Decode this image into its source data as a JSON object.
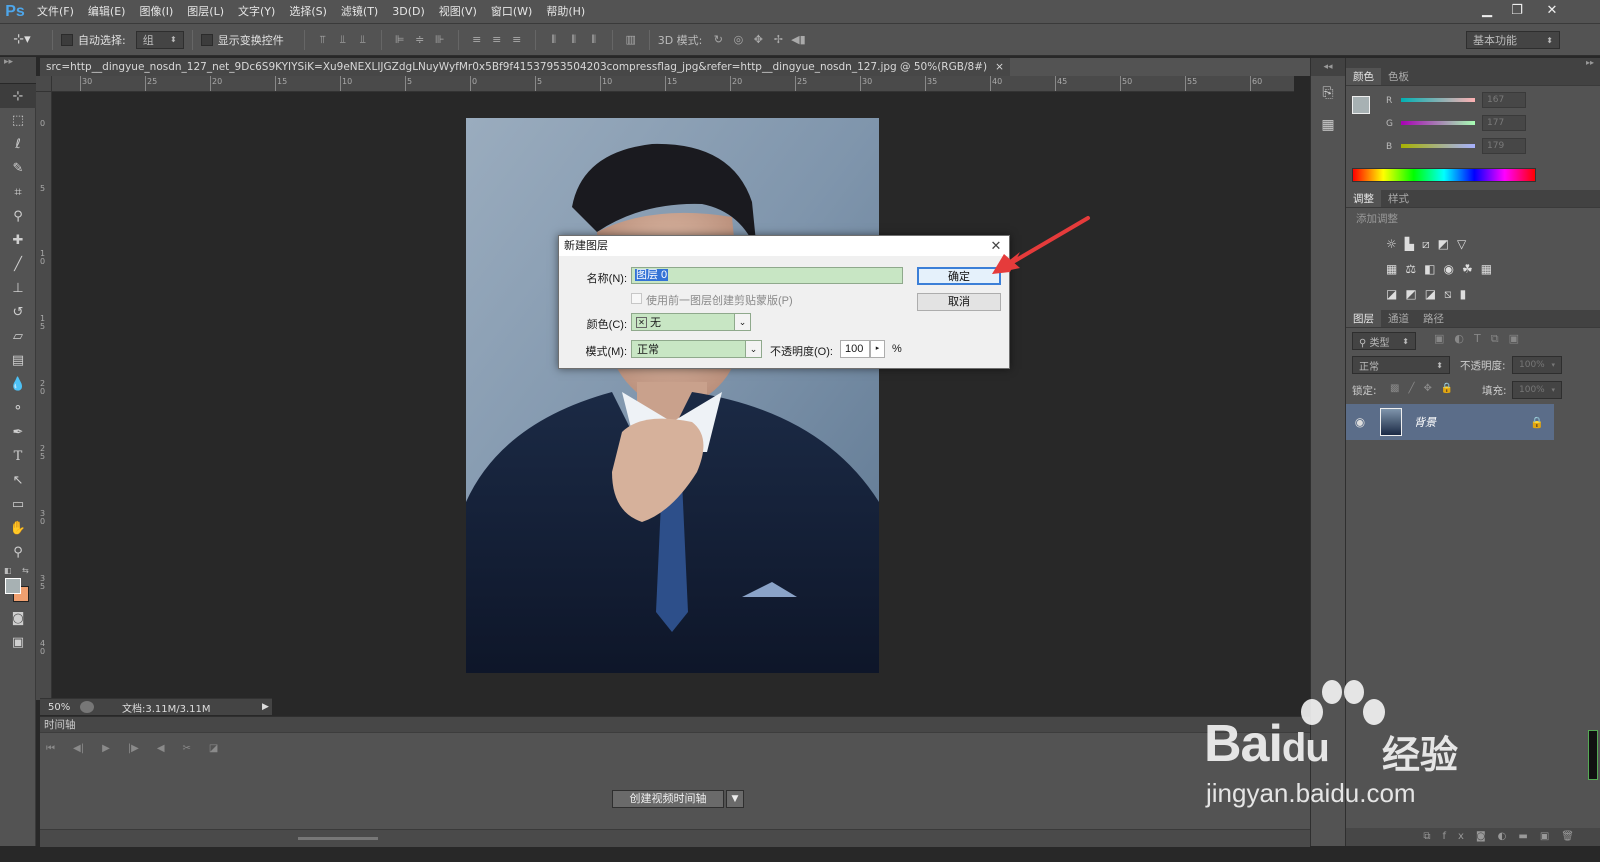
{
  "app": {
    "logo": "Ps"
  },
  "menu": [
    "文件(F)",
    "编辑(E)",
    "图像(I)",
    "图层(L)",
    "文字(Y)",
    "选择(S)",
    "滤镜(T)",
    "3D(D)",
    "视图(V)",
    "窗口(W)",
    "帮助(H)"
  ],
  "options": {
    "auto_select_label": "自动选择:",
    "auto_select_value": "组",
    "transform_controls_label": "显示变换控件",
    "mode_3d_label": "3D 模式:",
    "workspace": "基本功能"
  },
  "document": {
    "tab_title": "src=http__dingyue_nosdn_127_net_9Dc6S9KYIYSiK=Xu9eNEXLIJGZdgLNuyWyfMr0x5Bf9f41537953504203compressflag_jpg&refer=http__dingyue_nosdn_127.jpg @ 50%(RGB/8#)",
    "close_glyph": "×"
  },
  "rulers": {
    "h_ticks": [
      "30",
      "25",
      "20",
      "15",
      "10",
      "5",
      "0",
      "5",
      "10",
      "15",
      "20",
      "25",
      "30",
      "35",
      "40",
      "45",
      "50",
      "55",
      "60"
    ],
    "v_ticks": [
      "0",
      "5",
      "1\n0",
      "1\n5",
      "2\n0",
      "2\n5",
      "3\n0",
      "3\n5",
      "4\n0"
    ]
  },
  "status": {
    "zoom": "50%",
    "doc_info": "文档:3.11M/3.11M"
  },
  "timeline": {
    "title": "时间轴",
    "create_button": "创建视频时间轴"
  },
  "color_panel": {
    "tabs": [
      "颜色",
      "色板"
    ],
    "r_label": "R",
    "r_value": "167",
    "g_label": "G",
    "g_value": "177",
    "b_label": "B",
    "b_value": "179",
    "foreground": "#a7b1b3",
    "background": "#f0a070"
  },
  "adjust_panel": {
    "tabs": [
      "调整",
      "样式"
    ],
    "add_label": "添加调整"
  },
  "layers_panel": {
    "tabs": [
      "图层",
      "通道",
      "路径"
    ],
    "kind_filter": "类型",
    "blend_mode": "正常",
    "opacity_label": "不透明度:",
    "opacity_value": "100%",
    "lock_label": "锁定:",
    "fill_label": "填充:",
    "fill_value": "100%",
    "layer_name": "背景"
  },
  "dialog": {
    "title": "新建图层",
    "close_glyph": "✕",
    "name_label": "名称(N):",
    "name_value": "图层 0",
    "clip_label": "使用前一图层创建剪贴蒙版(P)",
    "color_label": "颜色(C):",
    "color_value": "无",
    "mode_label": "模式(M):",
    "mode_value": "正常",
    "opacity_label": "不透明度(O):",
    "opacity_value": "100",
    "percent": "%",
    "ok": "确定",
    "cancel": "取消"
  },
  "watermark": {
    "brand": "Bai",
    "brand2": "du",
    "sub": "经验",
    "url": "jingyan.baidu.com"
  }
}
